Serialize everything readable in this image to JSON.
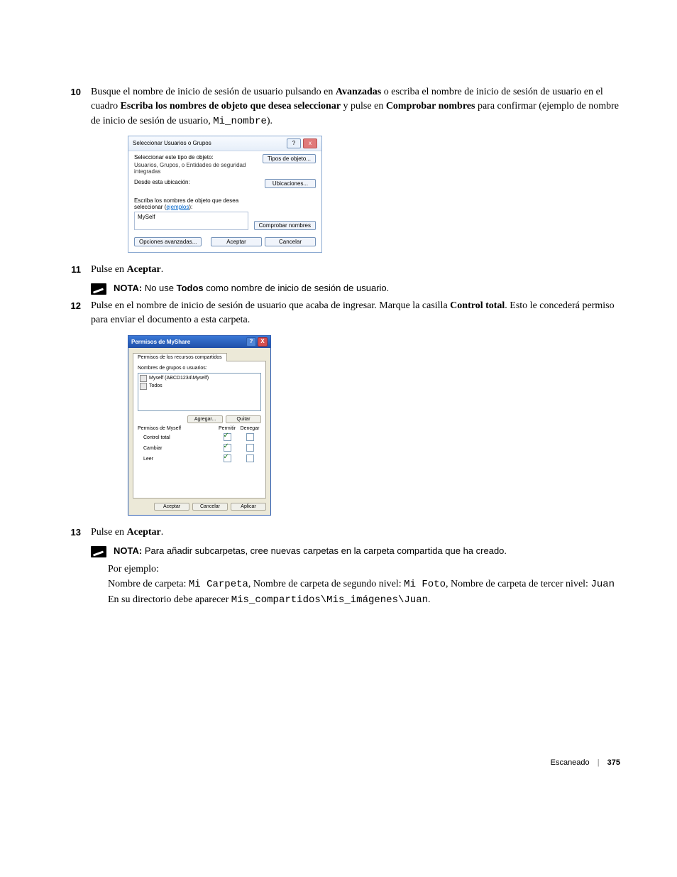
{
  "steps": {
    "s10": {
      "num": "10",
      "t1": "Busque el nombre de inicio de sesión de usuario pulsando en ",
      "b1": "Avanzadas",
      "t2": " o escriba el nombre de inicio de sesión de usuario en el cuadro ",
      "b2": "Escriba los nombres de objeto que desea seleccionar",
      "t3": " y pulse en ",
      "b3": "Comprobar nombres",
      "t4": " para confirmar (ejemplo de nombre de inicio de sesión de usuario, ",
      "m1": "Mi_nombre",
      "t5": ")."
    },
    "s11": {
      "num": "11",
      "t1": "Pulse en ",
      "b1": "Aceptar",
      "t2": "."
    },
    "s12": {
      "num": "12",
      "t1": "Pulse en el nombre de inicio de sesión de usuario que acaba de ingresar. Marque la casilla ",
      "b1": "Control total",
      "t2": ". Esto le concederá permiso para enviar el documento a esta carpeta."
    },
    "s13": {
      "num": "13",
      "t1": "Pulse en ",
      "b1": "Aceptar",
      "t2": "."
    }
  },
  "note1": {
    "label": "NOTA:",
    "text": " No use ",
    "bold": "Todos",
    "text2": " como nombre de inicio de sesión de usuario."
  },
  "note2": {
    "label": "NOTA:",
    "text": " Para añadir subcarpetas, cree nuevas carpetas en la carpeta compartida que ha creado."
  },
  "example": {
    "l1": "Por ejemplo:",
    "l2a": "Nombre de carpeta: ",
    "l2m1": "Mi Carpeta",
    "l2b": ", Nombre de carpeta de segundo nivel: ",
    "l2m2": "Mi Foto",
    "l2c": ", Nombre de carpeta de tercer nivel: ",
    "l2m3": "Juan",
    "l3a": "En su directorio debe aparecer ",
    "l3m": "Mis_compartidos\\Mis_imágenes\\Juan",
    "l3b": "."
  },
  "dlg1": {
    "title": "Seleccionar Usuarios o Grupos",
    "lbl_type": "Seleccionar este tipo de objeto:",
    "val_type": "Usuarios, Grupos, o Entidades de seguridad integradas",
    "btn_types": "Tipos de objeto...",
    "lbl_loc": "Desde esta ubicación:",
    "btn_loc": "Ubicaciones...",
    "lbl_names_a": "Escriba los nombres de objeto que desea seleccionar (",
    "lbl_names_link": "ejemplos",
    "lbl_names_b": "):",
    "input": "MySelf",
    "btn_check": "Comprobar nombres",
    "btn_adv": "Opciones avanzadas...",
    "btn_ok": "Aceptar",
    "btn_cancel": "Cancelar",
    "cap_help": "?",
    "cap_close": "x"
  },
  "dlg2": {
    "title": "Permisos de MyShare",
    "tab": "Permisos de los recursos compartidos",
    "lbl_groups": "Nombres de grupos o usuarios:",
    "li1": "Myself (ABCD1234\\Myself)",
    "li2": "Todos",
    "btn_add": "Agregar...",
    "btn_remove": "Quitar",
    "lbl_perm": "Permisos de Myself",
    "col_allow": "Permitir",
    "col_deny": "Denegar",
    "perm1": "Control total",
    "perm2": "Cambiar",
    "perm3": "Leer",
    "btn_ok": "Aceptar",
    "btn_cancel": "Cancelar",
    "btn_apply": "Aplicar",
    "cap_help": "?",
    "cap_close": "X"
  },
  "footer": {
    "section": "Escaneado",
    "page": "375"
  }
}
